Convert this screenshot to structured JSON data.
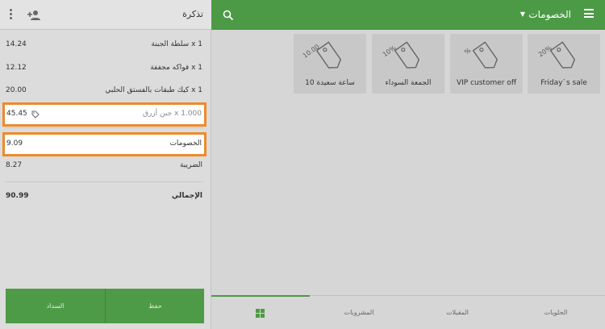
{
  "topbar": {
    "title": "الخصومات",
    "caret": "▼",
    "menu_icon": "menu-icon",
    "search_icon": "search-icon",
    "color": "#4c9a45"
  },
  "discounts": [
    {
      "tag": "20%",
      "name": "Friday`s sale"
    },
    {
      "tag": "%",
      "name": "VIP customer off"
    },
    {
      "tag": "10%",
      "name": "الجمعة السوداء"
    },
    {
      "tag": "10.00",
      "name": "ساعة سعيدة 10"
    }
  ],
  "bottom_tabs": [
    {
      "label": "",
      "icon": "grid-icon",
      "active": true
    },
    {
      "label": "المشروبات"
    },
    {
      "label": "المقبلات"
    },
    {
      "label": "الحلويات"
    }
  ],
  "ticket": {
    "title": "تذكرة",
    "add_customer_icon": "add-person-icon",
    "more_icon": "more-vert-icon",
    "items": [
      {
        "name": "سلطة الجبنة x 1",
        "value": "14.24"
      },
      {
        "name": "فواكه مجففة x 1",
        "value": "12.12"
      },
      {
        "name": "كيك طبقات بالفستق الحلبي x 1",
        "value": "20.00"
      },
      {
        "name": "جبن أزرق x 1.000",
        "value": "45.45",
        "highlighted": true
      }
    ],
    "discounts_label": "الخصومات",
    "discounts_value": "9.09",
    "tax_label": "الضريبة",
    "tax_value": "8.27",
    "total_label": "الإجمالي",
    "total_value": "90.99",
    "highlight_color": "#ef8a2a"
  },
  "actions": {
    "pay": "السداد",
    "save": "حفظ"
  }
}
